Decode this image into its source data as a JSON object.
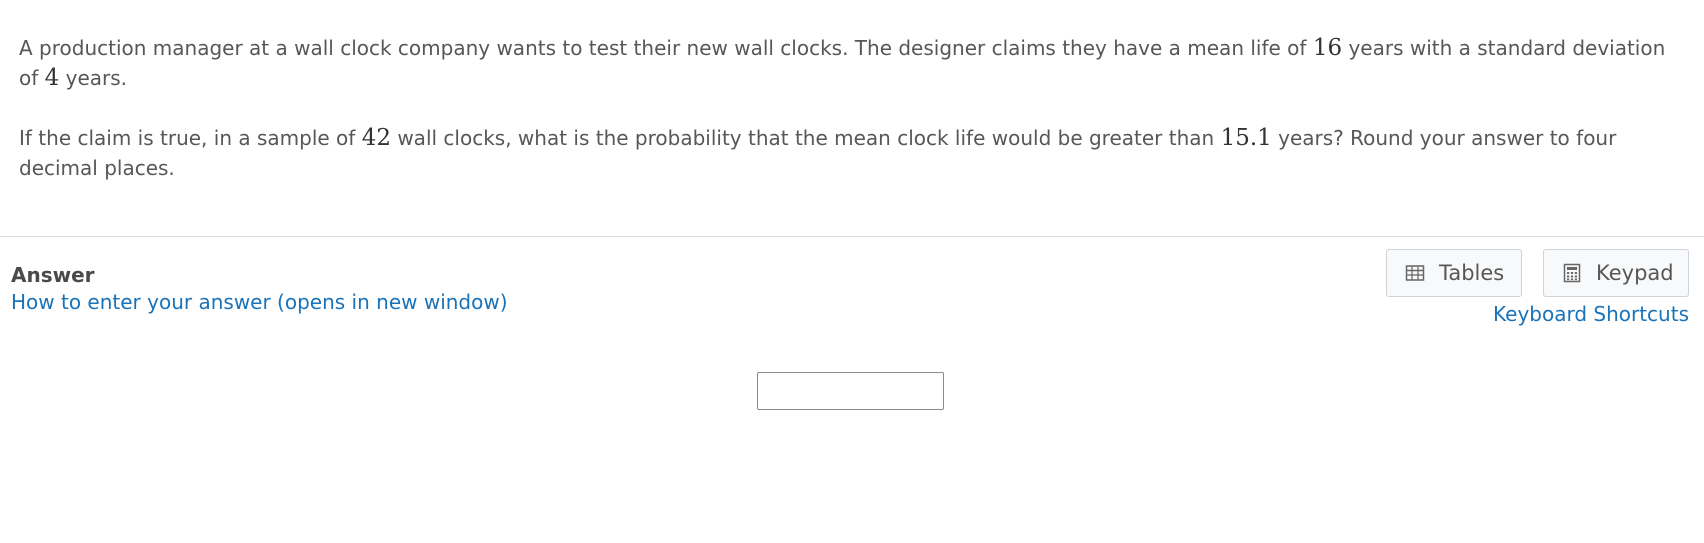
{
  "question": {
    "para1": {
      "t1": "A production manager at a wall clock company wants to test their new wall clocks.  The designer claims they have a mean life of ",
      "mean": "16",
      "t2": " years with a standard deviation of ",
      "sd": "4",
      "t3": " years."
    },
    "para2": {
      "t1": "If the claim is true, in a sample of ",
      "n": "42",
      "t2": " wall clocks, what is the probability that the mean clock life would be greater than ",
      "x": "15.1",
      "t3": " years? Round your answer to four decimal places."
    }
  },
  "answer": {
    "label": "Answer",
    "help_link": "How to enter your answer (opens in new window)",
    "input_value": ""
  },
  "tools": {
    "tables_label": "Tables",
    "keypad_label": "Keypad",
    "shortcuts_link": "Keyboard Shortcuts"
  },
  "icons": {
    "tables": "table-grid-icon",
    "keypad": "calculator-icon"
  },
  "colors": {
    "text": "#575757",
    "link": "#1a73b8",
    "divider": "#dcdcdc",
    "button_bg": "#f8f9fa",
    "button_border": "#cfd4d9"
  }
}
